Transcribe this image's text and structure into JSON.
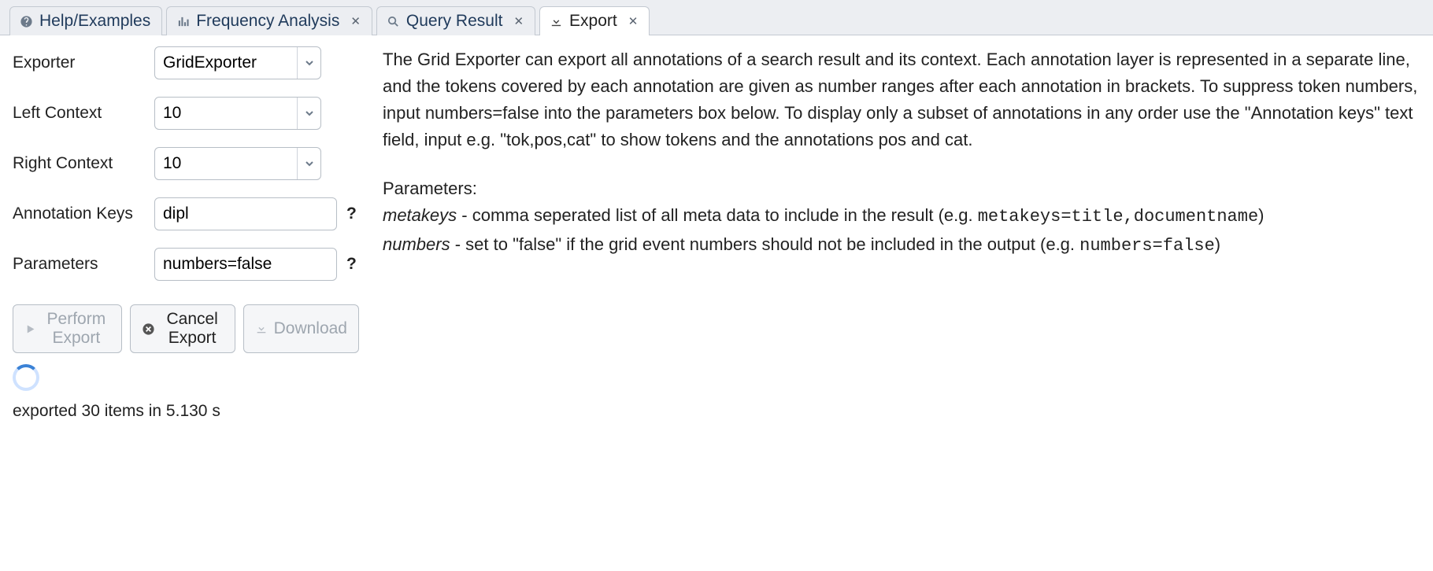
{
  "tabs": [
    {
      "label": "Help/Examples",
      "closable": false
    },
    {
      "label": "Frequency Analysis",
      "closable": true
    },
    {
      "label": "Query Result",
      "closable": true
    },
    {
      "label": "Export",
      "closable": true
    }
  ],
  "form": {
    "exporter": {
      "label": "Exporter",
      "value": "GridExporter"
    },
    "left_context": {
      "label": "Left Context",
      "value": "10"
    },
    "right_context": {
      "label": "Right Context",
      "value": "10"
    },
    "annotation_keys": {
      "label": "Annotation Keys",
      "value": "dipl",
      "help": "?"
    },
    "parameters": {
      "label": "Parameters",
      "value": "numbers=false",
      "help": "?"
    }
  },
  "description": {
    "intro": "The Grid Exporter can export all annotations of a search result and its context. Each annotation layer is represented in a separate line, and the tokens covered by each annotation are given as number ranges after each annotation in brackets. To suppress token numbers, input numbers=false into the parameters box below. To display only a subset of annotations in any order use the \"Annotation keys\" text field, input e.g. \"tok,pos,cat\" to show tokens and the annotations pos and cat.",
    "params_heading": "Parameters:",
    "metakeys_name": "metakeys",
    "metakeys_desc": " - comma seperated list of all meta data to include in the result (e.g. ",
    "metakeys_code": "metakeys=title,documentname",
    "close_paren": ")",
    "numbers_name": "numbers",
    "numbers_desc": " - set to \"false\" if the grid event numbers should not be included in the output (e.g. ",
    "numbers_code": "numbers=false"
  },
  "buttons": {
    "perform": "Perform Export",
    "cancel": "Cancel Export",
    "download": "Download"
  },
  "status": "exported 30 items in 5.130 s"
}
